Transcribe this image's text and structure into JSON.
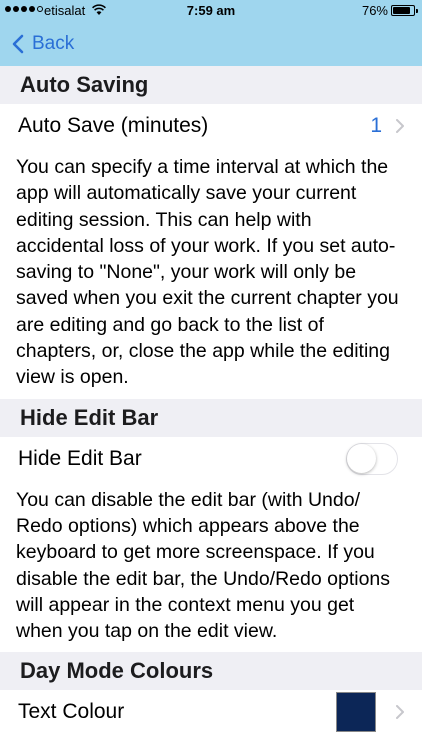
{
  "status_bar": {
    "carrier": "etisalat",
    "time": "7:59 am",
    "battery": "76%",
    "battery_level": 0.76
  },
  "nav": {
    "back_label": "Back"
  },
  "sections": {
    "auto_saving": {
      "header": "Auto Saving",
      "row_label": "Auto Save (minutes)",
      "row_value": "1",
      "description": "You can specify a time interval at which the app will automatically save your current editing session. This can help with accidental loss of your work. If you set auto-saving to \"None\", your work will only be saved when you exit the current chapter you are editing and go back to the list of chapters, or, close the app while the editing view is open."
    },
    "hide_edit_bar": {
      "header": "Hide Edit Bar",
      "row_label": "Hide Edit Bar",
      "toggle_on": false,
      "description": "You can disable the edit bar (with Undo/ Redo options) which appears above the keyboard to get more screenspace. If you disable the edit bar, the Undo/Redo options will appear in the context menu you get when you tap on the edit view."
    },
    "day_mode": {
      "header": "Day Mode Colours",
      "row_label": "Text Colour",
      "swatch_color": "#0c2657"
    }
  },
  "colors": {
    "nav_background": "#9fd6ee",
    "accent": "#2a6fd6",
    "section_background": "#efeff4"
  }
}
